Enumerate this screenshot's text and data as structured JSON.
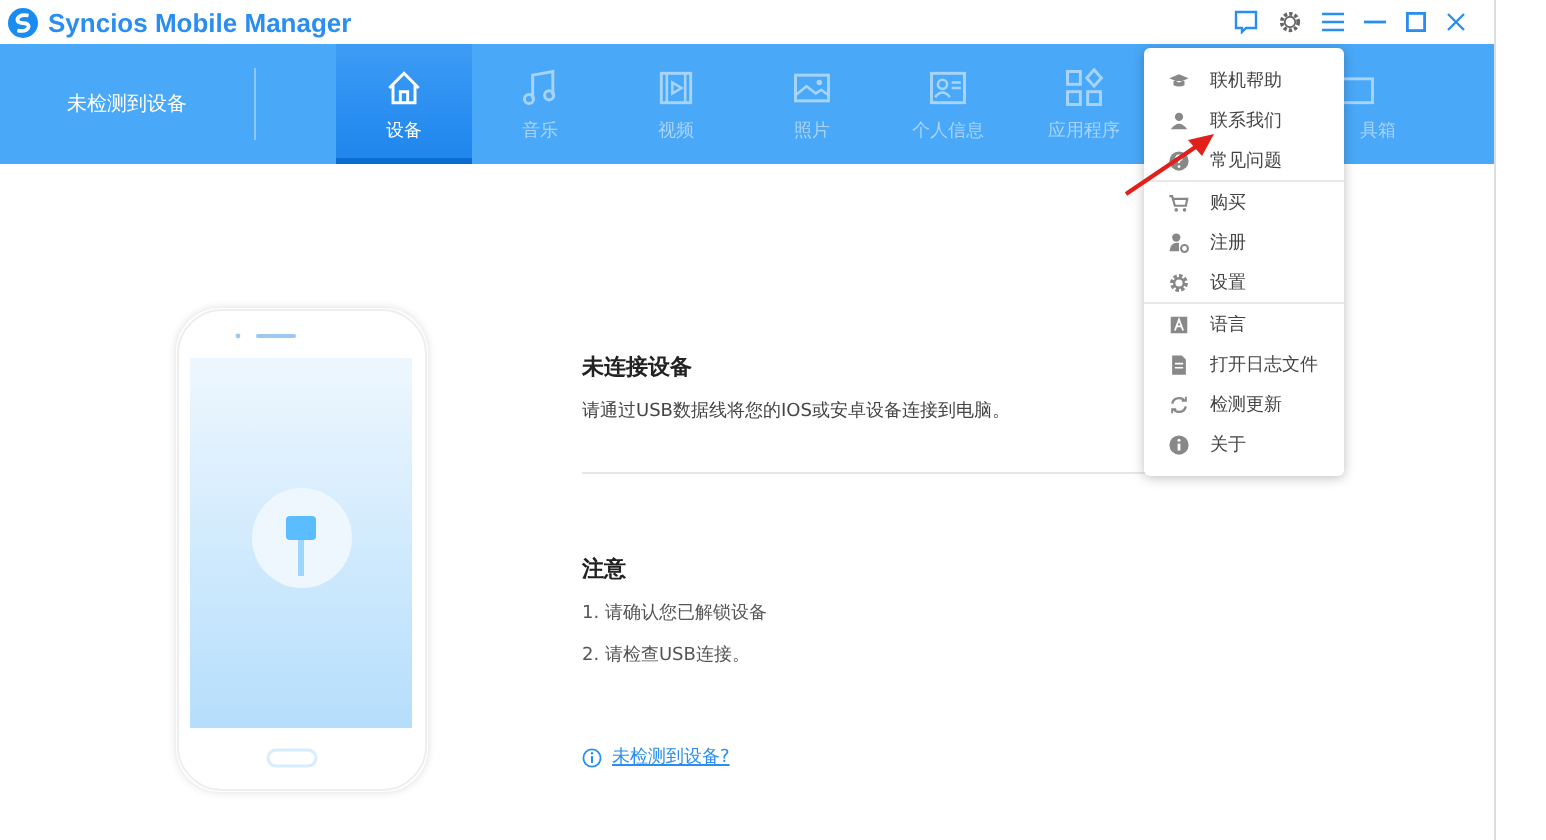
{
  "window": {
    "title": "Syncios Mobile Manager"
  },
  "header": {
    "device_status": "未检测到设备",
    "tabs": [
      {
        "label": "设备",
        "selected": true
      },
      {
        "label": "音乐",
        "selected": false
      },
      {
        "label": "视频",
        "selected": false
      },
      {
        "label": "照片",
        "selected": false
      },
      {
        "label": "个人信息",
        "selected": false
      },
      {
        "label": "应用程序",
        "selected": false
      },
      {
        "label": "具箱",
        "selected": false
      }
    ]
  },
  "menu": {
    "groups": [
      [
        "联机帮助",
        "联系我们",
        "常见问题"
      ],
      [
        "购买",
        "注册",
        "设置"
      ],
      [
        "语言",
        "打开日志文件",
        "检测更新",
        "关于"
      ]
    ]
  },
  "content": {
    "title": "未连接设备",
    "description": "请通过USB数据线将您的IOS或安卓设备连接到电脑。",
    "notice_title": "注意",
    "notices": [
      "1. 请确认您已解锁设备",
      "2. 请检查USB连接。"
    ],
    "help_link": "未检测到设备?"
  }
}
